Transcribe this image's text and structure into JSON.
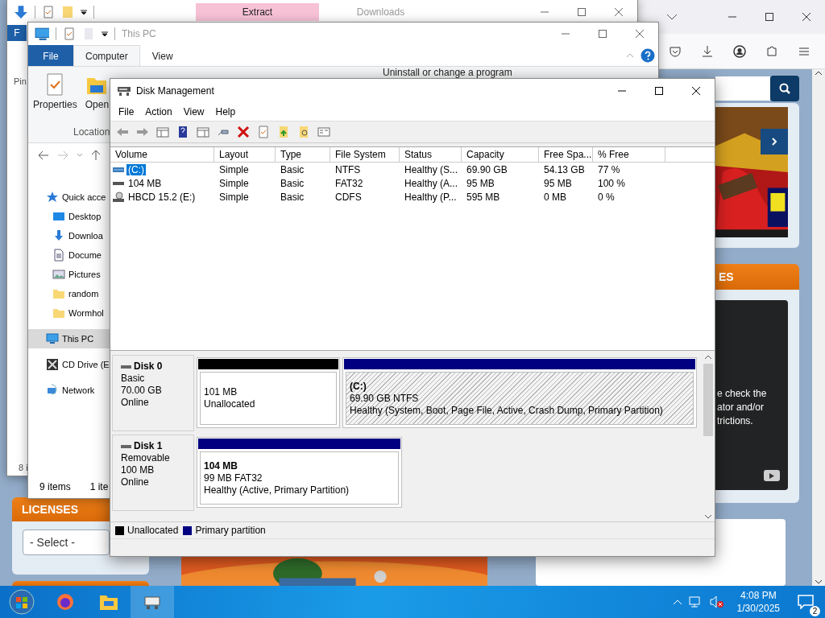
{
  "browser": {
    "page": {
      "side_header": "ES",
      "video_text": [
        "e check the",
        "ator and/or",
        "trictions."
      ],
      "licenses_header": "LICENSES",
      "select": {
        "value": "- Select -"
      }
    }
  },
  "back_window": {
    "tabs": [
      {
        "label": "Extract",
        "selected": true
      },
      {
        "label": "Downloads",
        "selected": false
      }
    ],
    "file_tab": "F",
    "ribbon_label": "Pin",
    "status": "8 i"
  },
  "explorer": {
    "title": "This PC",
    "tabs": [
      {
        "label": "File",
        "kind": "file",
        "selected": false
      },
      {
        "label": "Computer",
        "kind": "tab",
        "selected": true
      },
      {
        "label": "View",
        "kind": "tab",
        "selected": false
      }
    ],
    "ribbon": {
      "buttons": [
        {
          "label": "Properties",
          "kind": "properties"
        },
        {
          "label": "Open",
          "kind": "open"
        }
      ],
      "group_label": "Location",
      "link": "Uninstall or change a program"
    },
    "nav": [
      {
        "label": "Quick acce",
        "kind": "star",
        "selected": false,
        "children": [
          {
            "label": "Desktop",
            "kind": "desktop",
            "selected": false
          },
          {
            "label": "Downloa",
            "kind": "download",
            "selected": false
          },
          {
            "label": "Docume",
            "kind": "document",
            "selected": false
          },
          {
            "label": "Pictures",
            "kind": "pictures",
            "selected": false
          },
          {
            "label": "random",
            "kind": "folder",
            "selected": false
          },
          {
            "label": "Wormhol",
            "kind": "folder",
            "selected": false
          }
        ]
      },
      {
        "label": "This PC",
        "kind": "pc",
        "selected": true
      },
      {
        "label": "CD Drive (E",
        "kind": "cd",
        "selected": false
      },
      {
        "label": "Network",
        "kind": "network",
        "selected": false
      }
    ],
    "status": [
      "9 items",
      "1 ite"
    ]
  },
  "disk_management": {
    "title": "Disk Management",
    "menu": [
      "File",
      "Action",
      "View",
      "Help"
    ],
    "columns": [
      "Volume",
      "Layout",
      "Type",
      "File System",
      "Status",
      "Capacity",
      "Free Spa...",
      "% Free"
    ],
    "rows": [
      {
        "selected": true,
        "kind": "disk",
        "cells": [
          "(C:)",
          "Simple",
          "Basic",
          "NTFS",
          "Healthy (S...",
          "69.90 GB",
          "54.13 GB",
          "77 %"
        ]
      },
      {
        "selected": false,
        "kind": "removable",
        "cells": [
          "104 MB",
          "Simple",
          "Basic",
          "FAT32",
          "Healthy (A...",
          "95 MB",
          "95 MB",
          "100 %"
        ]
      },
      {
        "selected": false,
        "kind": "cd",
        "cells": [
          "HBCD 15.2 (E:)",
          "Simple",
          "Basic",
          "CDFS",
          "Healthy (P...",
          "595 MB",
          "0 MB",
          "0 %"
        ]
      }
    ],
    "disks": [
      {
        "name": "Disk 0",
        "type": "Basic",
        "size": "70.00 GB",
        "status": "Online",
        "partitions": [
          {
            "kind": "unallocated",
            "selected": false,
            "lines": [
              "101 MB",
              "Unallocated"
            ]
          },
          {
            "kind": "primary",
            "selected": true,
            "name": "(C:)",
            "lines": [
              "69.90 GB NTFS",
              "Healthy (System, Boot, Page File, Active, Crash Dump, Primary Partition)"
            ]
          }
        ]
      },
      {
        "name": "Disk 1",
        "type": "Removable",
        "size": "100 MB",
        "status": "Online",
        "partitions": [
          {
            "kind": "primary",
            "selected": false,
            "name": "104 MB",
            "lines": [
              "99 MB FAT32",
              "Healthy (Active, Primary Partition)"
            ]
          }
        ]
      }
    ],
    "legend": [
      {
        "label": "Unallocated",
        "color": "#000000"
      },
      {
        "label": "Primary partition",
        "color": "#000080"
      }
    ]
  },
  "taskbar": {
    "time": "4:08 PM",
    "date": "1/30/2025",
    "notifications": "2"
  }
}
